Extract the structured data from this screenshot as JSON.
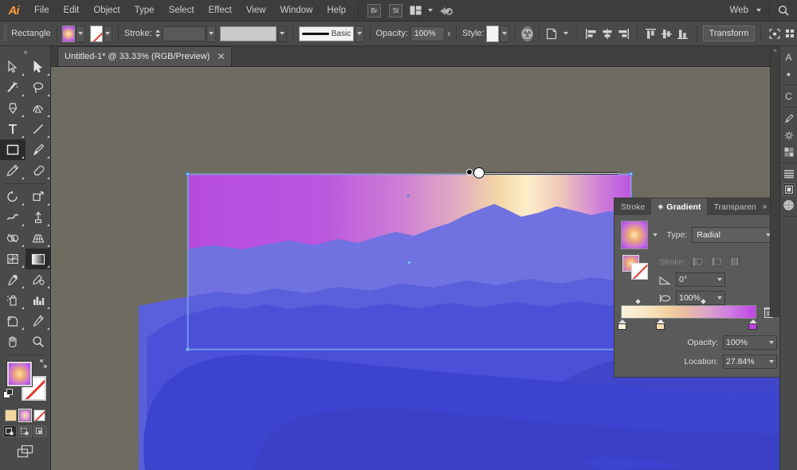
{
  "app": {
    "name": "Adobe Illustrator",
    "logo_text": "Ai"
  },
  "menubar": {
    "items": [
      "File",
      "Edit",
      "Object",
      "Type",
      "Select",
      "Effect",
      "View",
      "Window",
      "Help"
    ],
    "bridge_label": "Br",
    "stock_label": "St",
    "arrange_icon": "arrange-documents-icon",
    "chevron_icon": "chevron-down-icon",
    "sync_icon": "sync-settings-icon",
    "workspace_label": "Web",
    "workspace_chevron": "chevron-down-icon",
    "search_icon": "search-icon"
  },
  "controlbar": {
    "grip_icon": "drag-grip-icon",
    "object_type": "Rectangle",
    "fill_swatch_name": "fill-gradient-swatch",
    "fill_dropdown_icon": "chevron-down-icon",
    "stroke_swatch_name": "stroke-none-swatch",
    "stroke_dropdown_icon": "chevron-down-icon",
    "stroke_label": "Stroke:",
    "stroke_weight_value": "",
    "stroke_weight_placeholder": "",
    "stroke_weight_chevron": "chevron-down-icon",
    "stroke_profile_value": "",
    "stroke_profile_chevron": "chevron-down-icon",
    "brush_definition": "Basic",
    "brush_chevron": "chevron-down-icon",
    "opacity_label": "Opacity:",
    "opacity_value": "100%",
    "opacity_more_icon": "chevron-right-icon",
    "style_label": "Style:",
    "style_chevron": "chevron-down-icon",
    "recolor_icon": "recolor-artwork-icon",
    "document_setup_icon": "document-setup-icon",
    "document_setup_chevron": "chevron-down-icon",
    "align_left_icon": "align-left-icon",
    "align_center_h_icon": "align-center-horizontal-icon",
    "align_right_icon": "align-right-icon",
    "align_top_icon": "align-top-icon",
    "align_center_v_icon": "align-center-vertical-icon",
    "align_bottom_icon": "align-bottom-icon",
    "transform_label": "Transform",
    "isolate_icon": "isolate-selected-icon",
    "more_options_icon": "more-options-icon"
  },
  "tabbar": {
    "document_title": "Untitled-1* @ 33.33% (RGB/Preview)",
    "close_icon": "close-icon"
  },
  "toolbar": {
    "handle_icon": "panel-collapse-icon",
    "tools": [
      {
        "name": "selection-tool",
        "glyph": "cursor"
      },
      {
        "name": "direct-selection-tool",
        "glyph": "cursor-white"
      },
      {
        "name": "magic-wand-tool",
        "glyph": "wand"
      },
      {
        "name": "lasso-tool",
        "glyph": "lasso"
      },
      {
        "name": "pen-tool",
        "glyph": "pen"
      },
      {
        "name": "curvature-tool",
        "glyph": "curvature"
      },
      {
        "name": "type-tool",
        "glyph": "type"
      },
      {
        "name": "line-segment-tool",
        "glyph": "line"
      },
      {
        "name": "rectangle-tool",
        "glyph": "rectangle"
      },
      {
        "name": "paintbrush-tool",
        "glyph": "brush"
      },
      {
        "name": "pencil-tool",
        "glyph": "pencil"
      },
      {
        "name": "eraser-tool",
        "glyph": "eraser"
      },
      {
        "name": "rotate-tool",
        "glyph": "rotate"
      },
      {
        "name": "scale-tool",
        "glyph": "scale"
      },
      {
        "name": "width-warp-tool",
        "glyph": "warp"
      },
      {
        "name": "free-transform-tool",
        "glyph": "free-transform"
      },
      {
        "name": "shape-builder-tool",
        "glyph": "shape-builder"
      },
      {
        "name": "perspective-grid-tool",
        "glyph": "perspective"
      },
      {
        "name": "mesh-tool",
        "glyph": "mesh"
      },
      {
        "name": "gradient-tool",
        "glyph": "gradient",
        "selected": true
      },
      {
        "name": "eyedropper-tool",
        "glyph": "eyedropper"
      },
      {
        "name": "blend-tool",
        "glyph": "blend"
      },
      {
        "name": "symbol-sprayer-tool",
        "glyph": "symbol-sprayer"
      },
      {
        "name": "column-graph-tool",
        "glyph": "column-graph"
      },
      {
        "name": "artboard-tool",
        "glyph": "artboard"
      },
      {
        "name": "slice-tool",
        "glyph": "slice"
      },
      {
        "name": "hand-tool",
        "glyph": "hand"
      },
      {
        "name": "zoom-tool",
        "glyph": "zoom"
      }
    ],
    "fill_swatch_name": "fill-gradient-indicator",
    "stroke_swatch_name": "stroke-none-indicator",
    "swap_icon": "swap-fill-stroke-icon",
    "default_icon": "default-fill-stroke-icon",
    "color_mode_icon": "color-button",
    "gradient_mode_icon": "gradient-button",
    "none_mode_icon": "none-button",
    "draw_normal_icon": "draw-normal-icon",
    "draw_behind_icon": "draw-behind-icon",
    "draw_inside_icon": "draw-inside-icon",
    "screen_mode_icon": "change-screen-mode-icon"
  },
  "canvas": {
    "artboard_label": "artboard",
    "gradient_annotator_name": "gradient-annotator",
    "gradient_origin_name": "gradient-origin-handle",
    "gradient_endpoint_name": "gradient-endpoint-handle",
    "scrollbar_name": "canvas-vertical-scrollbar",
    "colors": {
      "canvas_bg": "#6e6b61",
      "sky_purple": "#b54ce0",
      "sky_cream": "#fbe9c4",
      "mountain_far": "#6f72e0",
      "mountain_mid": "#4a51d8",
      "mountain_near": "#3b43cf",
      "mountain_dark": "#3a3fc0",
      "selection_blue": "#7fa8ef"
    }
  },
  "gradient_panel": {
    "tabs": [
      {
        "label": "Stroke",
        "active": false
      },
      {
        "label": "Gradient",
        "active": true
      },
      {
        "label": "Transparen",
        "active": false
      }
    ],
    "collapse_icon": "double-chevron-icon",
    "menu_icon": "panel-menu-icon",
    "gradient_preview_name": "gradient-preview-swatch",
    "preview_chevron": "chevron-down-icon",
    "type_label": "Type:",
    "type_value": "Radial",
    "type_chevron": "chevron-down-icon",
    "fill_swatch_name": "panel-fill-swatch",
    "stroke_swatch_name": "panel-stroke-swatch",
    "reverse_icon": "reverse-gradient-icon",
    "stroke_label": "Stroke:",
    "stroke_opt_1_icon": "stroke-within-icon",
    "stroke_opt_2_icon": "stroke-along-icon",
    "stroke_opt_3_icon": "stroke-across-icon",
    "angle_icon": "gradient-angle-icon",
    "angle_value": "0°",
    "angle_chevron": "chevron-down-icon",
    "aspect_icon": "gradient-aspect-ratio-icon",
    "aspect_value": "100%",
    "aspect_chevron": "chevron-down-icon",
    "ramp_name": "gradient-slider-ramp",
    "delete_stop_icon": "delete-stop-trash-icon",
    "stops": [
      {
        "name": "gradient-stop-0",
        "position": 0,
        "color": "#fbf2e0"
      },
      {
        "name": "gradient-stop-1",
        "position": 27.84,
        "color": "#f6dcb0"
      },
      {
        "name": "gradient-stop-2",
        "position": 100,
        "color": "#c244e8"
      }
    ],
    "midpoints": [
      {
        "position": 13
      },
      {
        "position": 60
      }
    ],
    "opacity_label": "Opacity:",
    "opacity_value": "100%",
    "opacity_chevron": "chevron-down-icon",
    "location_label": "Location:",
    "location_value": "27.84%",
    "location_chevron": "chevron-down-icon",
    "ramp_gradient_css": "#fbf2e0 → #f2cf9d → #c244e8"
  },
  "right_dock": {
    "collapse_icon": "expand-panels-icon",
    "items": [
      {
        "name": "dock-appearance-panel",
        "glyph": "A"
      },
      {
        "name": "dock-graphic-styles-panel",
        "glyph": "●"
      },
      {
        "name": "dock-color-panel",
        "glyph": "C"
      },
      {
        "name": "dock-brushes-panel",
        "glyph": "brush"
      },
      {
        "name": "dock-symbols-panel",
        "glyph": "gear"
      },
      {
        "name": "dock-swatches-panel",
        "glyph": "swatch"
      },
      {
        "name": "dock-layers-panel",
        "glyph": "layers"
      },
      {
        "name": "dock-artboards-panel",
        "glyph": "artboard"
      },
      {
        "name": "dock-libraries-panel",
        "glyph": "globe"
      }
    ]
  }
}
